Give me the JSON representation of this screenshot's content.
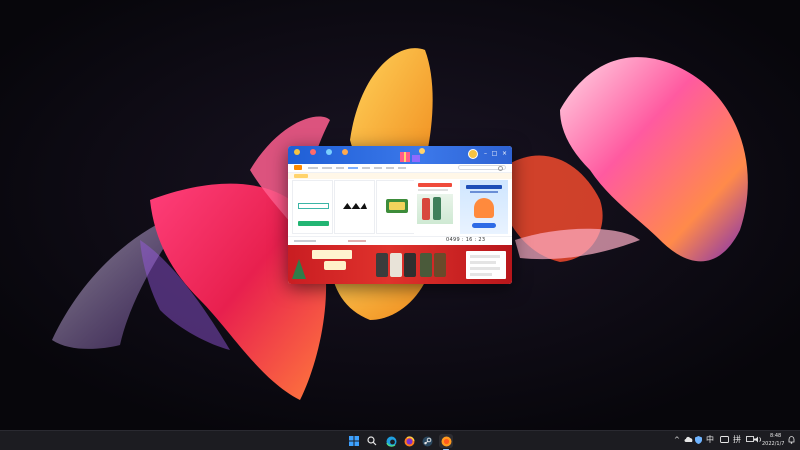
{
  "colors": {
    "taskbar": "#1c1c21",
    "app_header": "#2e62d2",
    "sale_banner": "#d0262a",
    "accent_orange": "#ff8a00"
  },
  "app": {
    "header_nav": [
      {
        "icon": "game-library-icon"
      },
      {
        "icon": "store-icon"
      },
      {
        "icon": "community-icon"
      },
      {
        "icon": "profile-icon"
      }
    ],
    "window_controls": {
      "minimize": "–",
      "maximize": "□",
      "close": "×"
    },
    "countdown": "0499 : 16 : 23"
  },
  "taskbar": {
    "icons": [
      "windows-start-icon",
      "search-icon",
      "edge-browser-icon",
      "firefox-icon",
      "steam-icon",
      "game-client-icon"
    ],
    "tray": {
      "chevron": "^",
      "ime": "中",
      "ime2": "拼"
    },
    "time": "8:48",
    "date": "2022/1/7"
  }
}
